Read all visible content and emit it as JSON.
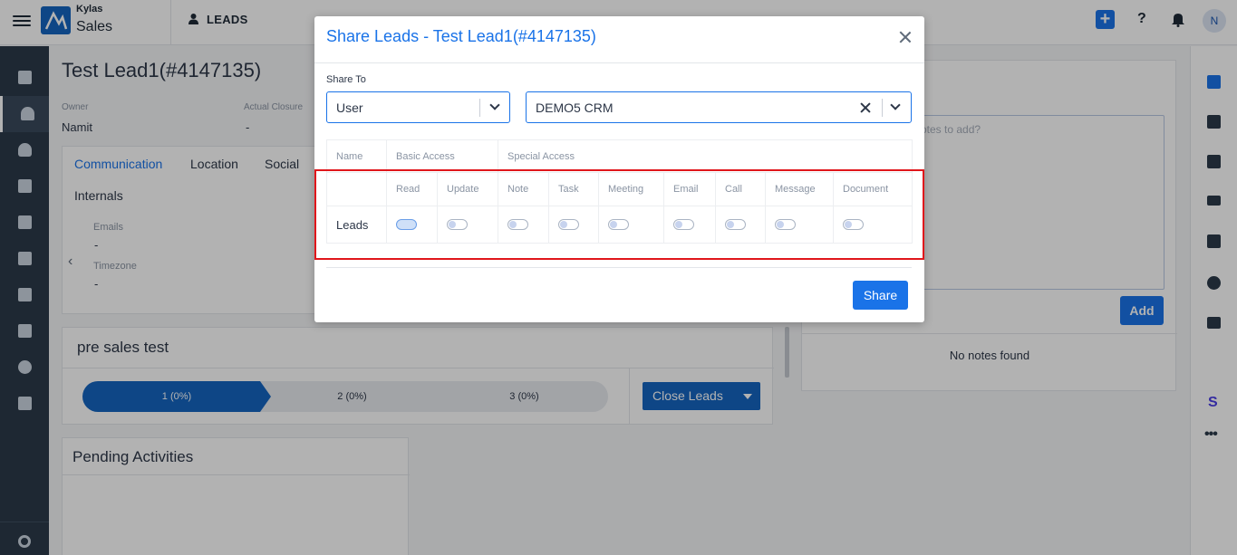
{
  "app": {
    "brand_top": "Kylas",
    "brand_main": "Sales",
    "nav_section": "LEADS",
    "avatar_initial": "N"
  },
  "lead": {
    "title": "Test Lead1(#4147135)",
    "owner_label": "Owner",
    "owner_value": "Namit",
    "closure_label": "Actual Closure",
    "closure_value": "-"
  },
  "details_tabs": [
    "Communication",
    "Location",
    "Social",
    "Internals"
  ],
  "details_fields": {
    "emails_label": "Emails",
    "emails_value": "-",
    "timezone_label": "Timezone",
    "timezone_value": "-"
  },
  "pipeline": {
    "title": "pre sales test",
    "stages": [
      "1 (0%)",
      "2 (0%)",
      "3 (0%)"
    ],
    "close_button": "Close Leads"
  },
  "pending": {
    "title": "Pending Activities"
  },
  "notes": {
    "placeholder_fragment": "otes to add?",
    "add_button": "Add",
    "empty": "No notes found"
  },
  "modal": {
    "title": "Share Leads - Test Lead1(#4147135)",
    "share_to_label": "Share To",
    "share_type": "User",
    "share_user": "DEMO5 CRM",
    "table": {
      "col_name": "Name",
      "group_basic": "Basic Access",
      "group_special": "Special Access",
      "permissions": [
        "Read",
        "Update",
        "Note",
        "Task",
        "Meeting",
        "Email",
        "Call",
        "Message",
        "Document"
      ],
      "row_label": "Leads",
      "states": [
        true,
        false,
        false,
        false,
        false,
        false,
        false,
        false,
        false
      ]
    },
    "share_button": "Share"
  },
  "colors": {
    "accent": "#1a73e8",
    "highlight": "#e0161b",
    "sidebar": "#2b3a4a"
  }
}
